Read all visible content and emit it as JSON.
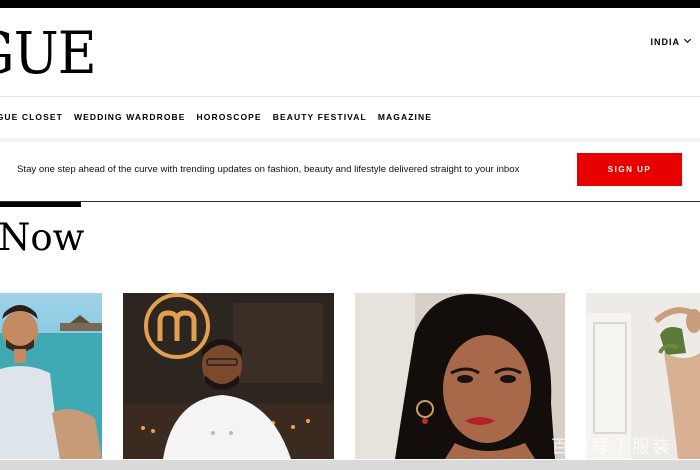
{
  "header": {
    "logo": "GUE",
    "region": "INDIA"
  },
  "nav": {
    "items": [
      "OGUE CLOSET",
      "WEDDING WARDROBE",
      "HOROSCOPE",
      "BEAUTY FESTIVAL",
      "MAGAZINE"
    ]
  },
  "newsletter": {
    "message": "Stay one step ahead of the curve with trending updates on fashion, beauty and lifestyle delivered straight to your inbox",
    "button": "SIGN UP"
  },
  "section": {
    "title": "Now"
  },
  "cards": [
    {
      "image": "man-at-beach-photo"
    },
    {
      "image": "chef-masterchef-photo"
    },
    {
      "image": "woman-portrait-photo"
    },
    {
      "image": "woman-pose-photo"
    }
  ],
  "watermark": "百家号 / 服装",
  "colors": {
    "accent": "#e60000",
    "text": "#000000"
  }
}
